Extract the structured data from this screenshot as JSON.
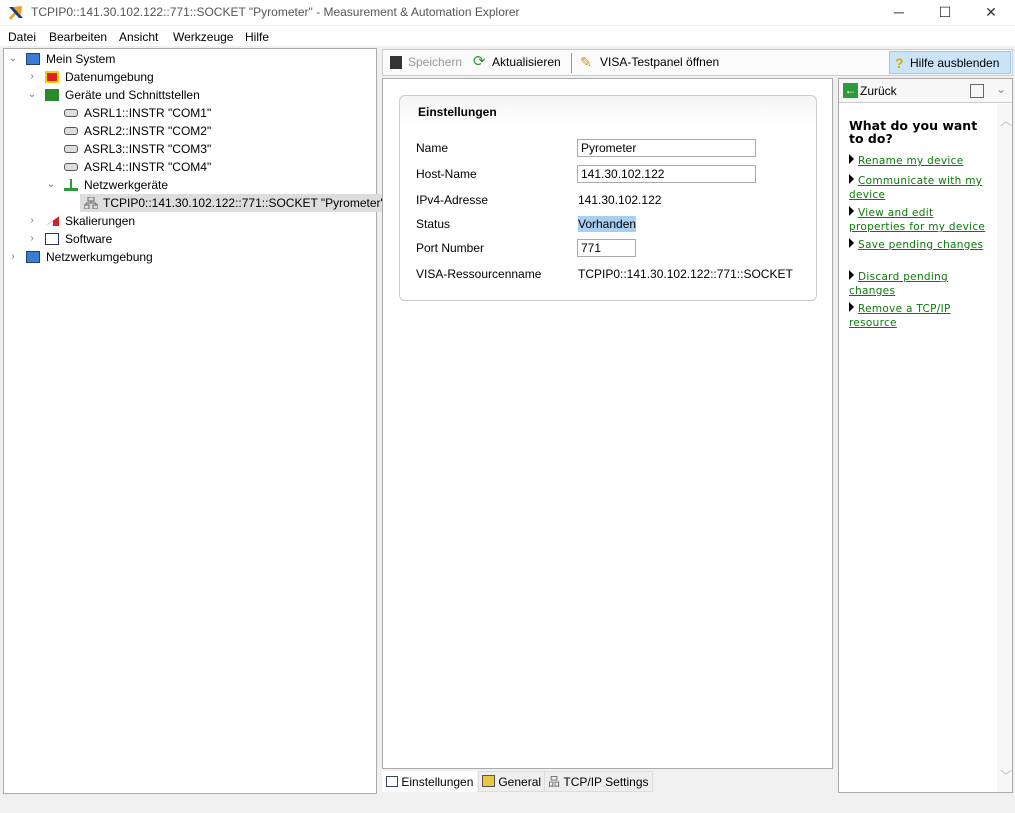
{
  "window": {
    "title": "TCPIP0::141.30.102.122::771::SOCKET \"Pyrometer\" - Measurement & Automation Explorer",
    "minimize": "─",
    "maximize": "☐",
    "close": "✕"
  },
  "menu": [
    "Datei",
    "Bearbeiten",
    "Ansicht",
    "Werkzeuge",
    "Hilfe"
  ],
  "tree": {
    "mein_system": "Mein System",
    "datenumgebung": "Datenumgebung",
    "geraete": "Geräte und Schnittstellen",
    "asrl": [
      "ASRL1::INSTR \"COM1\"",
      "ASRL2::INSTR \"COM2\"",
      "ASRL3::INSTR \"COM3\"",
      "ASRL4::INSTR \"COM4\""
    ],
    "netzwerkgeraete": "Netzwerkgeräte",
    "tcpip": "TCPIP0::141.30.102.122::771::SOCKET \"Pyrometer\"",
    "skalierungen": "Skalierungen",
    "software": "Software",
    "netzwerkumgebung": "Netzwerkumgebung"
  },
  "toolbar": {
    "save": "Speichern",
    "refresh": "Aktualisieren",
    "visa_panel": "VISA-Testpanel öffnen",
    "hide_help": "Hilfe ausblenden"
  },
  "settings": {
    "title": "Einstellungen",
    "name_label": "Name",
    "name_value": "Pyrometer",
    "host_label": "Host-Name",
    "host_value": "141.30.102.122",
    "ipv4_label": "IPv4-Adresse",
    "ipv4_value": "141.30.102.122",
    "status_label": "Status",
    "status_value": "Vorhanden",
    "port_label": "Port Number",
    "port_value": "771",
    "visa_label": "VISA-Ressourcenname",
    "visa_value": "TCPIP0::141.30.102.122::771::SOCKET"
  },
  "tabs": [
    "Einstellungen",
    "General",
    "TCP/IP Settings"
  ],
  "help": {
    "back": "Zurück",
    "heading": "What do you want to do?",
    "links": [
      "Rename my device",
      "Communicate with my device",
      "View and edit properties for my device",
      "Save pending changes",
      "Discard pending changes",
      "Remove a TCP/IP resource"
    ]
  }
}
